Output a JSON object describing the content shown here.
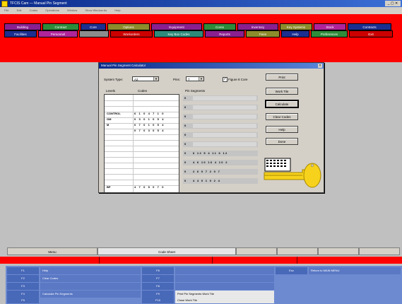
{
  "window": {
    "title": "TFCIS Cam — Manual Pin Segment",
    "controls": "_ ▢ ✕"
  },
  "menu": [
    "File",
    "Edit",
    "Codes",
    "Operations",
    "Window",
    "Show Window As",
    "Help"
  ],
  "top_tabs_row1": [
    {
      "label": "Building",
      "color": "#8a1f8f"
    },
    {
      "label": "Contract",
      "color": "#2e8b3a"
    },
    {
      "label": "Core",
      "color": "#1c2e8f"
    },
    {
      "label": "Options",
      "color": "#8c8c2c"
    },
    {
      "label": "Equipment",
      "color": "#8a1f8f"
    },
    {
      "label": "Cores",
      "color": "#2e8b3a"
    },
    {
      "label": "Inventory",
      "color": "#8a1f8f"
    },
    {
      "label": "Key Systems",
      "color": "#8c8c2c"
    },
    {
      "label": "Stock",
      "color": "#b0249a"
    },
    {
      "label": "Contracts",
      "color": "#1c2e8f"
    }
  ],
  "top_tabs_row2": [
    {
      "label": "Facilities",
      "color": "#1c2e8f"
    },
    {
      "label": "Personnel",
      "color": "#b0249a"
    },
    {
      "label": "",
      "color": "#8c8c8c"
    },
    {
      "label": "Workorders",
      "color": "#cc0000"
    },
    {
      "label": "Key Box Codes",
      "color": "#2e8b7a"
    },
    {
      "label": "Reports",
      "color": "#8a1f8f"
    },
    {
      "label": "Fees",
      "color": "#8c8c2c"
    },
    {
      "label": "Help",
      "color": "#1c2e8f"
    },
    {
      "label": "Preferences",
      "color": "#2e8b3a"
    },
    {
      "label": "Exit",
      "color": "#cc0000"
    }
  ],
  "dialog": {
    "title": "Manual Pin Segment Calculator",
    "system_type_label": "System Type:",
    "system_type_value": "A2",
    "pins_label": "Pins:",
    "pins_value": "7",
    "figure8_label": "Figure 8 Core",
    "figure8_checked": "✓",
    "col_levels": "Levels",
    "col_codes": "Codes",
    "col_pin_segments": "Pin Segments",
    "rows": [
      {
        "level": "CONTROL",
        "code": "6 1 0 4 7 1 0"
      },
      {
        "level": "GM",
        "code": "0 3 0 1 0 5 4"
      },
      {
        "level": "M",
        "code": "0 7 0 1 0 5 4"
      },
      {
        "level": "",
        "code": "0 7 0 3 0 5 4"
      },
      {
        "level": "BP",
        "code": "4 7 0 5 0 7 0"
      }
    ],
    "segments": [
      {
        "n": "0",
        "v": ""
      },
      {
        "n": "0",
        "v": ""
      },
      {
        "n": "0",
        "v": ""
      },
      {
        "n": "0",
        "v": ""
      },
      {
        "n": "0",
        "v": ""
      },
      {
        "n": "0",
        "v": ""
      },
      {
        "n": "0",
        "v": "6 12  5  4 11  6 12"
      },
      {
        "n": "0",
        "v": "4  6 10 16  4 10  2"
      },
      {
        "n": "0",
        "v": "2  6  0  7  2  0  7"
      },
      {
        "n": "0",
        "v": "4  4  0  1  0  2  4"
      }
    ],
    "buttons": [
      "Print",
      "Work Tile",
      "Calculate",
      "Clear Codes",
      "Help",
      "Done"
    ]
  },
  "bottom_tabs": [
    "Menu",
    "Code Sheet",
    "",
    "",
    "",
    ""
  ],
  "fkeys": {
    "row1": [
      {
        "key": "F1",
        "desc": "Help"
      },
      {
        "key": "F2",
        "desc": "Clear Codes"
      },
      {
        "key": "F3",
        "desc": ""
      },
      {
        "key": "F4",
        "desc": "Calculate Pin Segments"
      },
      {
        "key": "F5",
        "desc": ""
      }
    ],
    "row2": [
      {
        "key": "F6",
        "desc": ""
      },
      {
        "key": "F7",
        "desc": ""
      },
      {
        "key": "F8",
        "desc": ""
      },
      {
        "key": "F9",
        "desc": "Print Pin Segments Work Tile"
      },
      {
        "key": "F10",
        "desc": "Close Work Tile"
      }
    ],
    "esc": {
      "key": "Esc",
      "desc": "Return to MAIN MENU"
    }
  },
  "accent_red": "#ff0000",
  "icons": {
    "key_graphic": "key-icon",
    "keypad": "keypad-icon"
  }
}
